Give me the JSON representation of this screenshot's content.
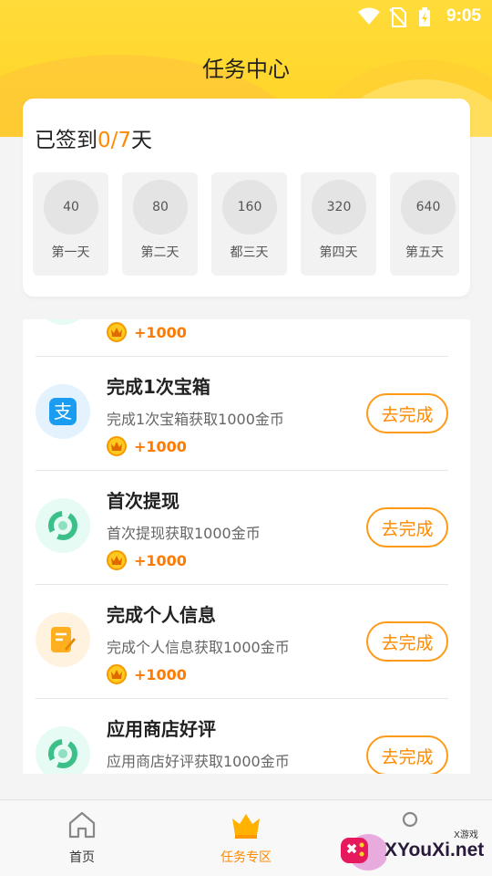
{
  "status_bar": {
    "time": "9:05"
  },
  "header": {
    "title": "任务中心"
  },
  "sign_in": {
    "prefix": "已签到",
    "count": "0/7",
    "suffix": "天",
    "days": [
      {
        "points": "40",
        "label": "第一天"
      },
      {
        "points": "80",
        "label": "第二天"
      },
      {
        "points": "160",
        "label": "都三天"
      },
      {
        "points": "320",
        "label": "第四天"
      },
      {
        "points": "640",
        "label": "第五天"
      }
    ]
  },
  "tasks": [
    {
      "reward": "+1000"
    },
    {
      "name": "完成1次宝箱",
      "desc": "完成1次宝箱获取1000金币",
      "reward": "+1000",
      "button": "去完成",
      "icon": "alipay-icon",
      "color": "#1a9cf0"
    },
    {
      "name": "首次提现",
      "desc": "首次提现获取1000金币",
      "reward": "+1000",
      "button": "去完成",
      "icon": "swirl-icon",
      "color": "#3cc08a"
    },
    {
      "name": "完成个人信息",
      "desc": "完成个人信息获取1000金币",
      "reward": "+1000",
      "button": "去完成",
      "icon": "edit-doc-icon",
      "color": "#ffb020"
    },
    {
      "name": "应用商店好评",
      "desc": "应用商店好评获取1000金币",
      "button": "去完成",
      "icon": "swirl-icon",
      "color": "#3cc08a"
    }
  ],
  "nav": {
    "home": "首页",
    "tasks": "任务专区"
  },
  "watermark": {
    "text": "XYouXi.net",
    "sub": "X游戏"
  },
  "colors": {
    "accent": "#ff8a00",
    "header": "#ffd324"
  }
}
